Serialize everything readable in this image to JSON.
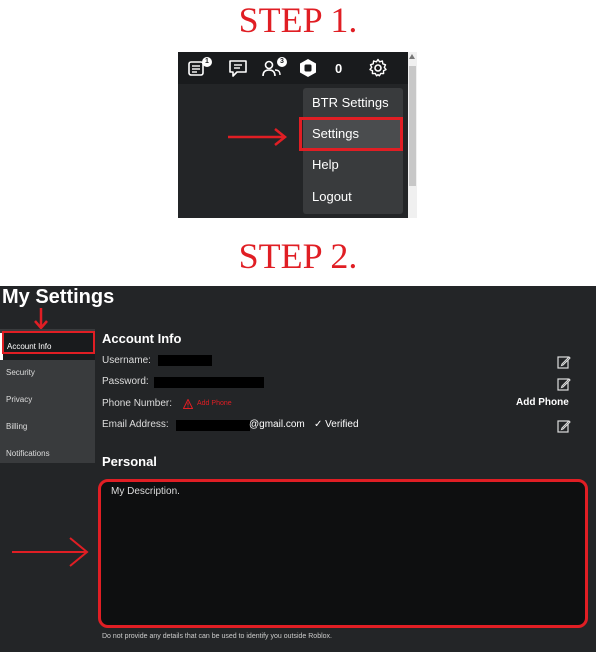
{
  "step1": {
    "title": "STEP 1.",
    "topbar": {
      "notifications_badge": "1",
      "friends_badge": "3",
      "robux_count": "0"
    },
    "dropdown": {
      "items": [
        "BTR Settings",
        "Settings",
        "Help",
        "Logout"
      ],
      "highlighted": "Settings"
    }
  },
  "step2": {
    "title": "STEP 2.",
    "page_title": "My Settings",
    "sidebar": {
      "items": [
        "Account Info",
        "Security",
        "Privacy",
        "Billing",
        "Notifications"
      ],
      "active": "Account Info"
    },
    "account_info": {
      "title": "Account Info",
      "username_label": "Username:",
      "password_label": "Password:",
      "phone_label": "Phone Number:",
      "add_phone_link": "Add Phone",
      "add_phone_button": "Add Phone",
      "email_label": "Email Address:",
      "email_suffix": "@gmail.com",
      "verified": "✓ Verified"
    },
    "personal": {
      "title": "Personal",
      "description": "My Description.",
      "note": "Do not provide any details that can be used to identify you outside Roblox."
    }
  },
  "colors": {
    "annotation_red": "#e01e24",
    "roblox_dark": "#232527",
    "menu_gray": "#393b3d"
  }
}
